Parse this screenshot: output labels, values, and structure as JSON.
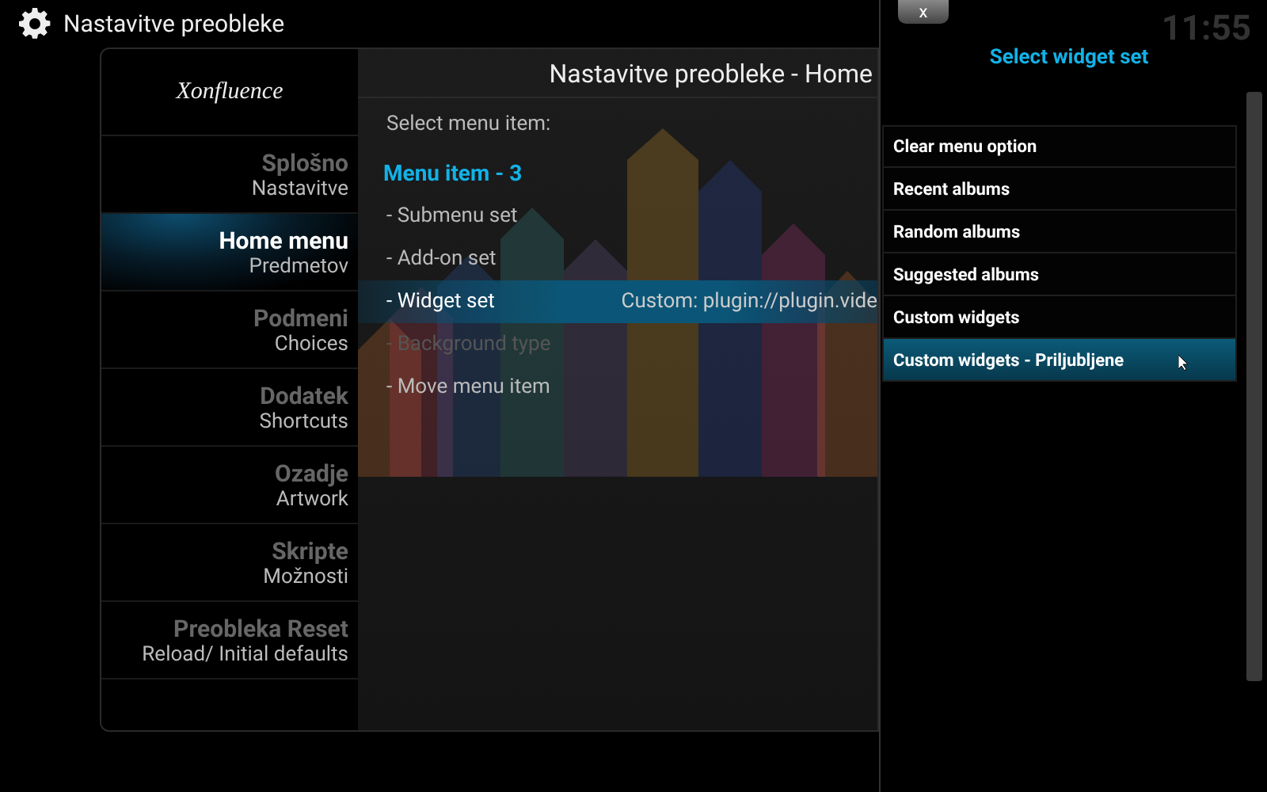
{
  "top_bar": {
    "title": "Nastavitve preobleke"
  },
  "dialog": {
    "logo": "Xonfluence",
    "header": "Nastavitve preobleke - Home",
    "sidebar": {
      "items": [
        {
          "title": "Splošno",
          "subtitle": "Nastavitve",
          "selected": false
        },
        {
          "title": "Home menu",
          "subtitle": "Predmetov",
          "selected": true
        },
        {
          "title": "Podmeni",
          "subtitle": "Choices",
          "selected": false
        },
        {
          "title": "Dodatek",
          "subtitle": "Shortcuts",
          "selected": false
        },
        {
          "title": "Ozadje",
          "subtitle": "Artwork",
          "selected": false
        },
        {
          "title": "Skripte",
          "subtitle": "Možnosti",
          "selected": false
        },
        {
          "title": "Preobleka Reset",
          "subtitle": "Reload/ Initial defaults",
          "selected": false
        }
      ]
    },
    "prompt": "Select menu item:",
    "menu_item": "Menu item - 3",
    "options": [
      {
        "label": "- Submenu set",
        "selected": false,
        "disabled": false
      },
      {
        "label": "- Add-on set",
        "selected": false,
        "disabled": false
      },
      {
        "label": "- Widget set",
        "value": "Custom: plugin://plugin.vide",
        "selected": true,
        "disabled": false
      },
      {
        "label": "- Background type",
        "selected": false,
        "disabled": true
      },
      {
        "label": "- Move menu item",
        "selected": false,
        "disabled": false
      }
    ]
  },
  "panel": {
    "close_button": "x",
    "clock": "11:55",
    "title": "Select widget set",
    "items": [
      {
        "label": "Clear menu option",
        "selected": false
      },
      {
        "label": "Recent albums",
        "selected": false
      },
      {
        "label": "Random albums",
        "selected": false
      },
      {
        "label": "Suggested albums",
        "selected": false
      },
      {
        "label": "Custom widgets",
        "selected": false
      },
      {
        "label": "Custom widgets - Priljubljene",
        "selected": true
      }
    ]
  }
}
